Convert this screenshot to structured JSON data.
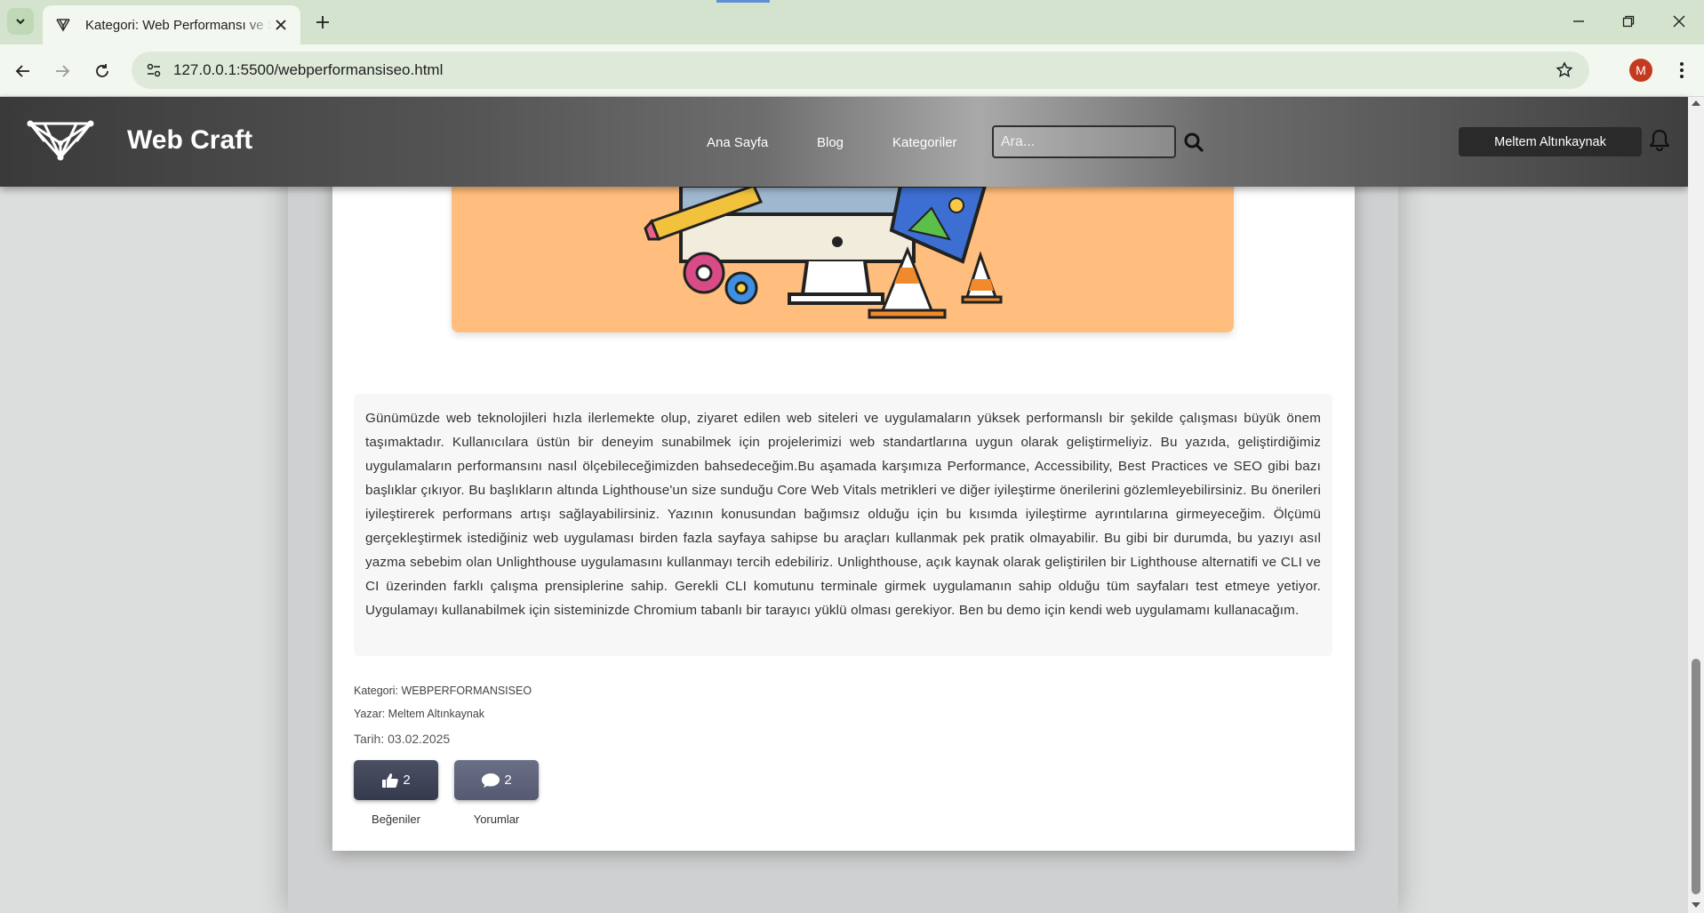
{
  "browser": {
    "tab_title": "Kategori: Web Performansı ve SEO",
    "url": "127.0.0.1:5500/webperformansiseo.html",
    "profile_initial": "M"
  },
  "header": {
    "brand": "Web Craft",
    "nav": [
      "Ana Sayfa",
      "Blog",
      "Kategoriler"
    ],
    "search_placeholder": "Ara...",
    "user_name": "Meltem Altınkaynak"
  },
  "article": {
    "body": "Günümüzde web teknolojileri hızla ilerlemekte olup, ziyaret edilen web siteleri ve uygulamaların yüksek performanslı bir şekilde çalışması büyük önem taşımaktadır. Kullanıcılara üstün bir deneyim sunabilmek için projelerimizi web standartlarına uygun olarak geliştirmeliyiz. Bu yazıda, geliştirdiğimiz uygulamaların performansını nasıl ölçebileceğimizden bahsedeceğim.Bu aşamada karşımıza Performance, Accessibility, Best Practices ve SEO gibi bazı başlıklar çıkıyor. Bu başlıkların altında Lighthouse'un size sunduğu Core Web Vitals metrikleri ve diğer iyileştirme önerilerini gözlemleyebilirsiniz. Bu önerileri iyileştirerek performans artışı sağlayabilirsiniz. Yazının konusundan bağımsız olduğu için bu kısımda iyileştirme ayrıntılarına girmeyeceğim. Ölçümü gerçekleştirmek istediğiniz web uygulaması birden fazla sayfaya sahipse bu araçları kullanmak pek pratik olmayabilir. Bu gibi bir durumda, bu yazıyı asıl yazma sebebim olan Unlighthouse uygulamasını kullanmayı tercih edebiliriz. Unlighthouse, açık kaynak olarak geliştirilen bir Lighthouse alternatifi ve CLI ve CI üzerinden farklı çalışma prensiplerine sahip. Gerekli CLI komutunu terminale girmek uygulamanın sahip olduğu tüm sayfaları test etmeye yetiyor. Uygulamayı kullanabilmek için sisteminizde Chromium tabanlı bir tarayıcı yüklü olması gerekiyor. Ben bu demo için kendi web uygulamamı kullanacağım.",
    "category": "Kategori: WEBPERFORMANSISEO",
    "author": "Yazar: Meltem Altınkaynak",
    "date": "Tarih: 03.02.2025",
    "likes_count": "2",
    "comments_count": "2",
    "likes_label": "Beğeniler",
    "comments_label": "Yorumlar"
  },
  "colors": {
    "hero_bg": "#ffbe7d",
    "button_dark": "#3d4155",
    "profile": "#c5391e"
  }
}
